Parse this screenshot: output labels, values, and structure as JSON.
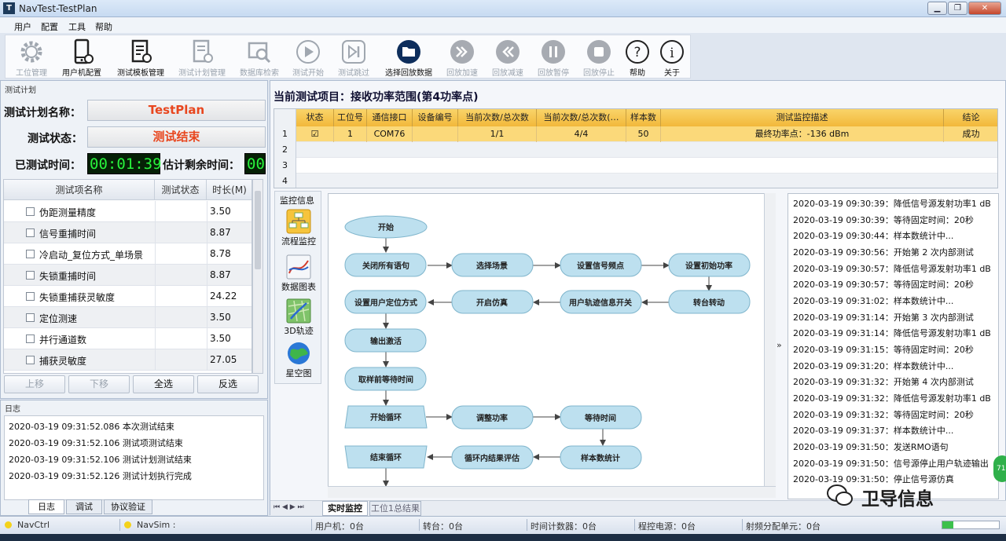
{
  "window": {
    "title": "NavTest-TestPlan",
    "app_icon": "T",
    "min": "▁",
    "restore": "❐",
    "close": "✕"
  },
  "menu": [
    "用户",
    "配置",
    "工具",
    "帮助"
  ],
  "toolbar": [
    {
      "label": "工位管理",
      "icon": "gear-icon",
      "enabled": false
    },
    {
      "label": "用户机配置",
      "icon": "phone-icon",
      "enabled": true
    },
    {
      "label": "测试模板管理",
      "icon": "template-icon",
      "enabled": true
    },
    {
      "label": "测试计划管理",
      "icon": "plan-icon",
      "enabled": false
    },
    {
      "label": "数据库检索",
      "icon": "database-search-icon",
      "enabled": false
    },
    {
      "label": "测试开始",
      "icon": "play-icon",
      "enabled": false
    },
    {
      "label": "测试跳过",
      "icon": "skip-icon",
      "enabled": false
    },
    {
      "label": "选择回放数据",
      "icon": "folder-icon",
      "enabled": true
    },
    {
      "label": "回放加速",
      "icon": "fast-forward-icon",
      "enabled": false
    },
    {
      "label": "回放减速",
      "icon": "rewind-icon",
      "enabled": false
    },
    {
      "label": "回放暂停",
      "icon": "pause-icon",
      "enabled": false
    },
    {
      "label": "回放停止",
      "icon": "stop-icon",
      "enabled": false
    },
    {
      "label": "帮助",
      "icon": "help-icon",
      "enabled": true
    },
    {
      "label": "关于",
      "icon": "info-icon",
      "enabled": true
    }
  ],
  "left": {
    "section_title": "测试计划",
    "plan_name_label": "测试计划名称：",
    "plan_name": "TestPlan",
    "status_label": "测试状态：",
    "status": "测试结束",
    "elapsed_label": "已测试时间：",
    "elapsed": "00:01:39",
    "remaining_label": "估计剩余时间：",
    "remaining": "00",
    "columns": [
      "测试项名称",
      "测试状态",
      "时长(M)"
    ],
    "items": [
      {
        "name": "伪距测量精度",
        "duration": "3.50"
      },
      {
        "name": "信号重捕时间",
        "duration": "8.87"
      },
      {
        "name": "冷启动_复位方式_单场景",
        "duration": "8.78"
      },
      {
        "name": "失锁重捕时间",
        "duration": "8.87"
      },
      {
        "name": "失锁重捕获灵敏度",
        "duration": "24.22"
      },
      {
        "name": "定位测速",
        "duration": "3.50"
      },
      {
        "name": "并行通道数",
        "duration": "3.50"
      },
      {
        "name": "捕获灵敏度",
        "duration": "27.05"
      }
    ],
    "buttons": {
      "up": "上移",
      "down": "下移",
      "select_all": "全选",
      "invert": "反选"
    }
  },
  "log": {
    "title": "日志",
    "lines": [
      "2020-03-19 09:31:52.086 本次测试结束",
      "2020-03-19 09:31:52.106 测试项测试结束",
      "2020-03-19 09:31:52.106 测试计划测试结束",
      "2020-03-19 09:31:52.126 测试计划执行完成"
    ],
    "tabs": [
      "日志",
      "调试",
      "协议验证"
    ]
  },
  "right": {
    "project_title": "当前测试项目：接收功率范围(第4功率点)",
    "grid_headers": [
      "状态",
      "工位号",
      "通信接口",
      "设备编号",
      "当前次数/总次数",
      "当前次数/总次数(…",
      "样本数",
      "测试监控描述",
      "结论"
    ],
    "grid_rows": [
      {
        "num": "1",
        "checked": "☑",
        "station": "1",
        "port": "COM76",
        "device": "",
        "count1": "1/1",
        "count2": "4/4",
        "samples": "50",
        "desc": "最终功率点：-136 dBm",
        "result": "成功"
      },
      {
        "num": "2"
      },
      {
        "num": "3"
      },
      {
        "num": "4"
      }
    ],
    "monitor_title": "监控信息",
    "monitor_items": [
      {
        "label": "流程监控",
        "icon": "flow-monitor-icon"
      },
      {
        "label": "数据图表",
        "icon": "data-chart-icon"
      },
      {
        "label": "3D轨迹",
        "icon": "trajectory-3d-icon"
      },
      {
        "label": "星空图",
        "icon": "skyplot-icon"
      }
    ],
    "flow_nodes": {
      "start": "开始",
      "close_all": "关闭所有语句",
      "select_scene": "选择场景",
      "set_freq": "设置信号频点",
      "set_power": "设置初始功率",
      "set_pos_mode": "设置用户定位方式",
      "start_sim": "开启仿真",
      "track_switch": "用户轨迹信息开关",
      "turntable": "转台转动",
      "output_activate": "输出激活",
      "wait_before_sample": "取样前等待时间",
      "loop_start": "开始循环",
      "adjust_power": "调整功率",
      "wait_time": "等待时间",
      "loop_end": "结束循环",
      "loop_eval": "循环内结果评估",
      "sample_stats": "样本数统计"
    },
    "log_lines": [
      "2020-03-19 09:30:39：降低信号源发射功率1 dB",
      "2020-03-19 09:30:39：等待固定时间：20秒",
      "2020-03-19 09:30:44：样本数统计中...",
      "2020-03-19 09:30:56：开始第 2 次内部测试",
      "2020-03-19 09:30:57：降低信号源发射功率1 dB",
      "2020-03-19 09:30:57：等待固定时间：20秒",
      "2020-03-19 09:31:02：样本数统计中...",
      "2020-03-19 09:31:14：开始第 3 次内部测试",
      "2020-03-19 09:31:14：降低信号源发射功率1 dB",
      "2020-03-19 09:31:15：等待固定时间：20秒",
      "2020-03-19 09:31:20：样本数统计中...",
      "2020-03-19 09:31:32：开始第 4 次内部测试",
      "2020-03-19 09:31:32：降低信号源发射功率1 dB",
      "2020-03-19 09:31:32：等待固定时间：20秒",
      "2020-03-19 09:31:37：样本数统计中...",
      "2020-03-19 09:31:50：发送RMO语句",
      "2020-03-19 09:31:50：信号源停止用户轨迹输出",
      "2020-03-19 09:31:50：停止信号源仿真"
    ],
    "tabs": [
      "实时监控",
      "工位1总结果"
    ],
    "expander": "»",
    "float_badge": "71"
  },
  "status": {
    "navctrl": "NavCtrl",
    "navsim": "NavSim :",
    "user_machine": "用户机：0台",
    "turntable": "转台：0台",
    "timer": "时间计数器：0台",
    "power": "程控电源：0台",
    "rf_unit": "射频分配单元：0台"
  },
  "watermark": "卫导信息"
}
